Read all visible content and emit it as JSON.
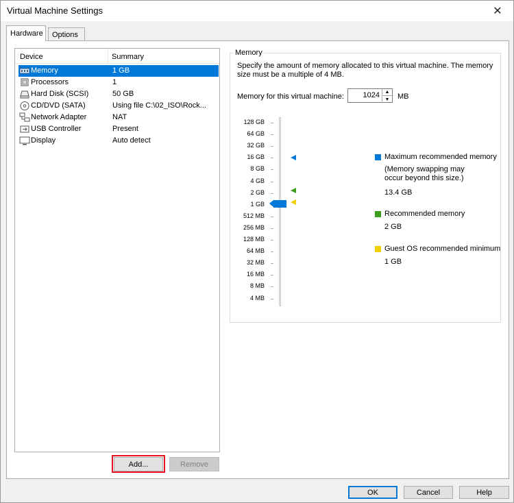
{
  "window": {
    "title": "Virtual Machine Settings"
  },
  "tabs": [
    {
      "label": "Hardware",
      "active": true
    },
    {
      "label": "Options",
      "active": false
    }
  ],
  "device_list": {
    "columns": {
      "device": "Device",
      "summary": "Summary"
    },
    "rows": [
      {
        "device": "Memory",
        "summary": "1 GB",
        "icon": "memory-icon",
        "selected": true
      },
      {
        "device": "Processors",
        "summary": "1",
        "icon": "processor-icon",
        "selected": false
      },
      {
        "device": "Hard Disk (SCSI)",
        "summary": "50 GB",
        "icon": "hard-disk-icon",
        "selected": false
      },
      {
        "device": "CD/DVD (SATA)",
        "summary": "Using file C:\\02_ISO\\Rock...",
        "icon": "cd-dvd-icon",
        "selected": false
      },
      {
        "device": "Network Adapter",
        "summary": "NAT",
        "icon": "network-adapter-icon",
        "selected": false
      },
      {
        "device": "USB Controller",
        "summary": "Present",
        "icon": "usb-icon",
        "selected": false
      },
      {
        "device": "Display",
        "summary": "Auto detect",
        "icon": "display-icon",
        "selected": false
      }
    ]
  },
  "buttons": {
    "add": "Add...",
    "remove": "Remove",
    "ok": "OK",
    "cancel": "Cancel",
    "help": "Help"
  },
  "memory": {
    "group_title": "Memory",
    "description": "Specify the amount of memory allocated to this virtual machine. The memory size must be a multiple of 4 MB.",
    "field_label": "Memory for this virtual machine:",
    "value": "1024",
    "unit": "MB",
    "scale": [
      "128 GB",
      "64 GB",
      "32 GB",
      "16 GB",
      "8 GB",
      "4 GB",
      "2 GB",
      "1 GB",
      "512 MB",
      "256 MB",
      "128 MB",
      "64 MB",
      "32 MB",
      "16 MB",
      "8 MB",
      "4 MB"
    ],
    "slider_level": "1 GB",
    "legend": {
      "max_label": "Maximum recommended memory",
      "max_note": "(Memory swapping may occur beyond this size.)",
      "max_value": "13.4 GB",
      "rec_label": "Recommended memory",
      "rec_value": "2 GB",
      "min_label": "Guest OS recommended minimum",
      "min_value": "1 GB"
    }
  },
  "colors": {
    "accent": "#0078d7",
    "recommended": "#3c9c1c",
    "minimum": "#f0d000",
    "highlight": "#e81123"
  }
}
